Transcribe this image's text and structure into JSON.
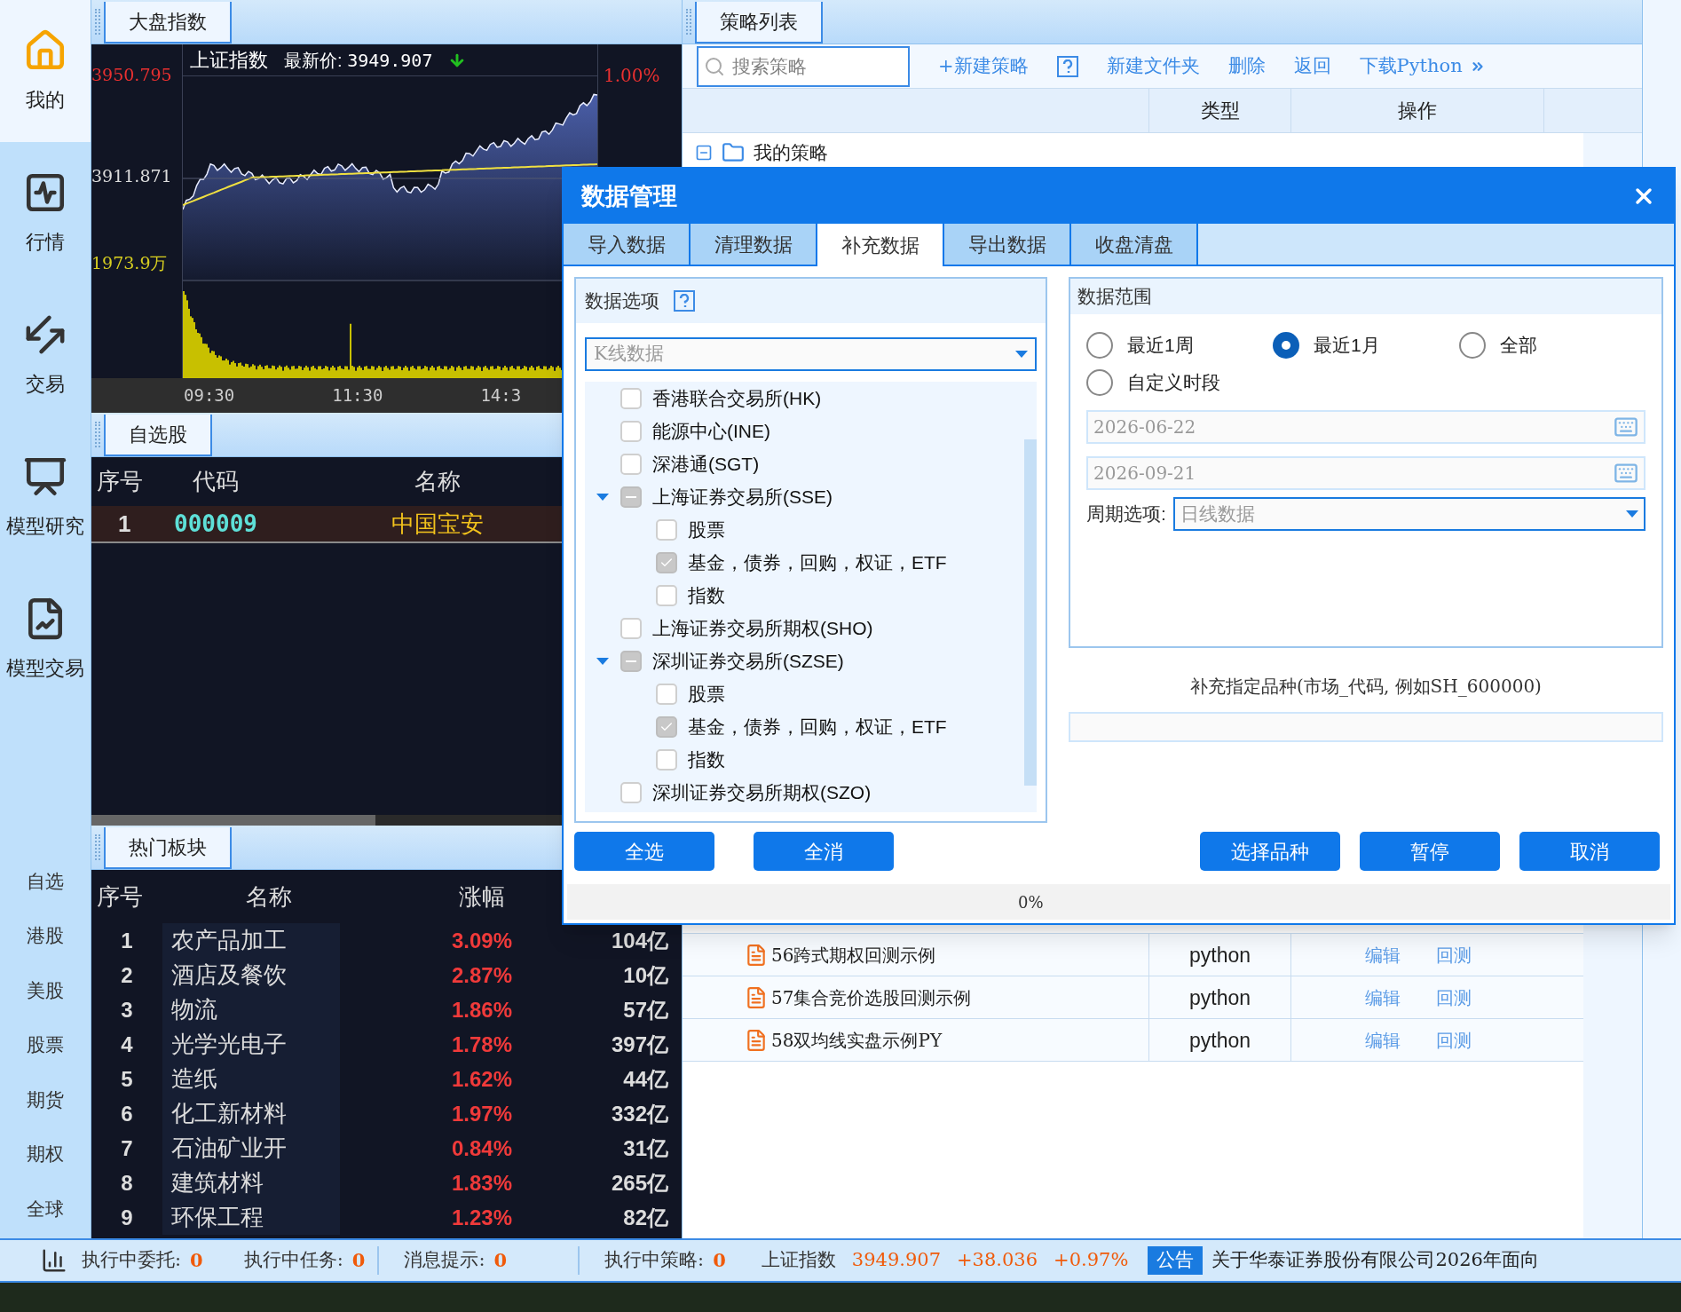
{
  "sidebar": {
    "items": [
      {
        "label": "我的",
        "selected": true
      },
      {
        "label": "行情",
        "selected": false
      },
      {
        "label": "交易",
        "selected": false
      },
      {
        "label": "模型研究",
        "selected": false
      },
      {
        "label": "模型交易",
        "selected": false
      }
    ],
    "markets": [
      "自选",
      "港股",
      "美股",
      "股票",
      "期货",
      "期权",
      "全球"
    ]
  },
  "index_panel": {
    "tab": "大盘指数",
    "name": "上证指数",
    "price_label": "最新价:",
    "price": "3949.907",
    "falling": true,
    "high": "3950.795",
    "mid": "3911.871",
    "volume": "1973.9万",
    "pct": "1.00%",
    "times": [
      "09:30",
      "11:30",
      "14:3"
    ]
  },
  "watchlist": {
    "tab": "自选股",
    "columns": [
      "序号",
      "代码",
      "名称"
    ],
    "rows": [
      {
        "index": "1",
        "code": "000009",
        "name": "中国宝安",
        "selected": true
      }
    ]
  },
  "hot_sectors": {
    "tab": "热门板块",
    "columns": [
      "序号",
      "名称",
      "涨幅"
    ],
    "rows": [
      {
        "index": "1",
        "name": "农产品加工",
        "change": "3.09%",
        "amount": "104亿"
      },
      {
        "index": "2",
        "name": "酒店及餐饮",
        "change": "2.87%",
        "amount": "10亿"
      },
      {
        "index": "3",
        "name": "物流",
        "change": "1.86%",
        "amount": "57亿"
      },
      {
        "index": "4",
        "name": "光学光电子",
        "change": "1.78%",
        "amount": "397亿"
      },
      {
        "index": "5",
        "name": "造纸",
        "change": "1.62%",
        "amount": "44亿"
      },
      {
        "index": "6",
        "name": "化工新材料",
        "change": "1.97%",
        "amount": "332亿"
      },
      {
        "index": "7",
        "name": "石油矿业开",
        "change": "0.84%",
        "amount": "31亿"
      },
      {
        "index": "8",
        "name": "建筑材料",
        "change": "1.83%",
        "amount": "265亿"
      },
      {
        "index": "9",
        "name": "环保工程",
        "change": "1.23%",
        "amount": "82亿"
      }
    ]
  },
  "strategies": {
    "tab": "策略列表",
    "search": {
      "placeholder": "搜索策略"
    },
    "actions": [
      "+新建策略",
      "新建文件夹",
      "删除",
      "返回",
      "下载Python"
    ],
    "columns": [
      "类型",
      "操作"
    ],
    "root": {
      "name": "我的策略",
      "expanded": true
    },
    "rows": [
      {
        "name": "56跨式期权回测示例",
        "type": "python",
        "actions": [
          "编辑",
          "回测"
        ]
      },
      {
        "name": "57集合竞价选股回测示例",
        "type": "python",
        "actions": [
          "编辑",
          "回测"
        ]
      },
      {
        "name": "58双均线实盘示例PY",
        "type": "python",
        "actions": [
          "编辑",
          "回测"
        ]
      }
    ]
  },
  "dialog": {
    "title": "数据管理",
    "tabs": [
      {
        "label": "导入数据",
        "selected": false
      },
      {
        "label": "清理数据",
        "selected": false
      },
      {
        "label": "补充数据",
        "selected": true
      },
      {
        "label": "导出数据",
        "selected": false
      },
      {
        "label": "收盘清盘",
        "selected": false
      }
    ],
    "data_options": {
      "title": "数据选项",
      "select": "K线数据",
      "tree": [
        {
          "label": "香港联合交易所(HK)",
          "checked": false,
          "indeterminate": false
        },
        {
          "label": "能源中心(INE)",
          "checked": false,
          "indeterminate": false
        },
        {
          "label": "深港通(SGT)",
          "checked": false,
          "indeterminate": false
        },
        {
          "label": "上海证券交易所(SSE)",
          "checked": false,
          "indeterminate": true,
          "expanded": true,
          "children": [
            {
              "label": "股票",
              "checked": false
            },
            {
              "label": "基金，债券，回购，权证，ETF",
              "checked": true
            },
            {
              "label": "指数",
              "checked": false
            }
          ]
        },
        {
          "label": "上海证券交易所期权(SHO)",
          "checked": false,
          "indeterminate": false
        },
        {
          "label": "深圳证券交易所(SZSE)",
          "checked": false,
          "indeterminate": true,
          "expanded": true,
          "children": [
            {
              "label": "股票",
              "checked": false
            },
            {
              "label": "基金，债券，回购，权证，ETF",
              "checked": true
            },
            {
              "label": "指数",
              "checked": false
            }
          ]
        },
        {
          "label": "深圳证券交易所期权(SZO)",
          "checked": false,
          "indeterminate": false
        }
      ],
      "buttons": [
        "全选",
        "全消"
      ]
    },
    "data_range": {
      "title": "数据范围",
      "radios": [
        {
          "label": "最近1周",
          "selected": false
        },
        {
          "label": "最近1月",
          "selected": true
        },
        {
          "label": "全部",
          "selected": false
        },
        {
          "label": "自定义时段",
          "selected": false
        }
      ],
      "dates": [
        {
          "value": "2026-06-22",
          "disabled": true
        },
        {
          "value": "2026-09-21",
          "disabled": true
        }
      ],
      "period_label": "周期选项:",
      "period": "日线数据"
    },
    "hint": "补充指定品种(市场_代码, 例如SH_600000)",
    "buttons": [
      "选择品种",
      "暂停",
      "取消"
    ],
    "progress": {
      "text": "0%",
      "level": 0
    }
  },
  "status_bar": {
    "items": [
      {
        "label": "执行中委托:",
        "value": "0"
      },
      {
        "label": "执行中任务:",
        "value": "0"
      },
      {
        "label": "消息提示:",
        "value": "0"
      },
      {
        "label": "执行中策略:",
        "value": "0"
      }
    ],
    "index_name": "上证指数",
    "index_price": "3949.907",
    "index_change": "+38.036",
    "index_pct": "+0.97%",
    "notice_badge": "公告",
    "notice": "关于华泰证券股份有限公司2026年面向"
  }
}
